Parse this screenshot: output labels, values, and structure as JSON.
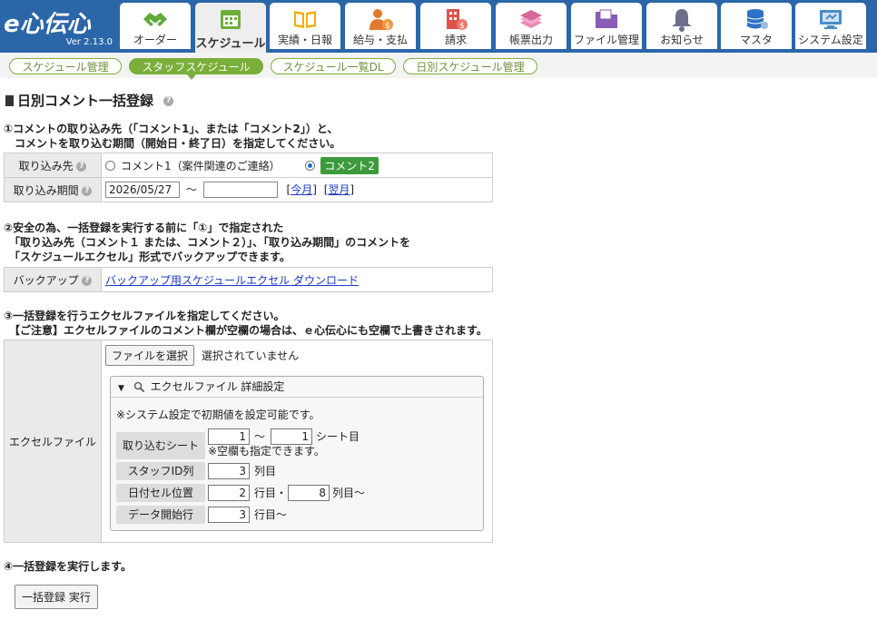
{
  "app": {
    "brand": "e心伝心",
    "version": "Ver 2.13.0"
  },
  "tabs": [
    {
      "label": "オーダー",
      "icon": "handshake-icon"
    },
    {
      "label": "スケジュール",
      "icon": "calendar-icon"
    },
    {
      "label": "実績・日報",
      "icon": "book-icon"
    },
    {
      "label": "給与・支払",
      "icon": "person-money-icon"
    },
    {
      "label": "請求",
      "icon": "building-money-icon"
    },
    {
      "label": "帳票出力",
      "icon": "papers-icon"
    },
    {
      "label": "ファイル管理",
      "icon": "folder-icon"
    },
    {
      "label": "お知らせ",
      "icon": "bell-icon"
    },
    {
      "label": "マスタ",
      "icon": "database-icon"
    },
    {
      "label": "システム設定",
      "icon": "monitor-settings-icon"
    }
  ],
  "subnav": [
    "スケジュール管理",
    "スタッフスケジュール",
    "スケジュール一覧DL",
    "日別スケジュール管理"
  ],
  "page_title": "日別コメント一括登録",
  "step1": {
    "line1": "①コメントの取り込み先（「コメント1」、または「コメント2」）と、",
    "line2": "　コメントを取り込む期間（開始日・終了日）を指定してください。",
    "target_label": "取り込み先",
    "option1": "コメント1（案件関連のご連絡）",
    "option2": "コメント2",
    "period_label": "取り込み期間",
    "start_date": "2026/05/27",
    "tilde": "～",
    "end_date": "",
    "this_month": "今月",
    "next_month": "翌月"
  },
  "step2": {
    "line1": "②安全の為、一括登録を実行する前に「①」で指定された",
    "line2": "　「取り込み先（コメント１ または、コメント２）」、「取り込み期間」のコメントを",
    "line3": "　「スケジュールエクセル」形式でバックアップできます。",
    "backup_label": "バックアップ",
    "backup_link": "バックアップ用スケジュールエクセル ダウンロード"
  },
  "step3": {
    "line1": "③一括登録を行うエクセルファイルを指定してください。",
    "line2": "　【ご注意】エクセルファイルのコメント欄が空欄の場合は、ｅ心伝心にも空欄で上書きされます。",
    "file_label": "エクセルファイル",
    "file_button": "ファイルを選択",
    "file_status": "選択されていません",
    "detail_title": "エクセルファイル 詳細設定",
    "detail_note": "※システム設定で初期値を設定可能です。",
    "sheet_label": "取り込むシート",
    "sheet_from": "1",
    "sheet_sep": "～",
    "sheet_to": "1",
    "sheet_suffix": "シート目",
    "sheet_note": "※空欄も指定できます。",
    "staff_label": "スタッフID列",
    "staff_col": "3",
    "col_suffix": "列目",
    "date_label": "日付セル位置",
    "date_row": "2",
    "row_sep": "行目・",
    "date_col": "8",
    "col_from": "列目～",
    "data_label": "データ開始行",
    "data_row": "3",
    "row_from": "行目～"
  },
  "step4": {
    "line1": "④一括登録を実行します。",
    "run_button": "一括登録 実行"
  }
}
